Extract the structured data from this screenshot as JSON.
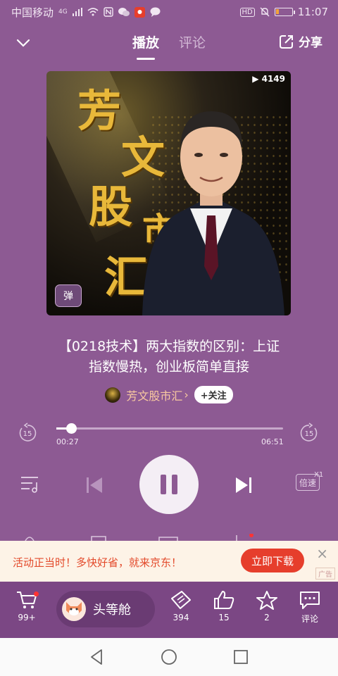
{
  "status_bar": {
    "carrier": "中国移动",
    "network": "4G",
    "hd_label": "HD",
    "time": "11:07",
    "battery_level": 0.22,
    "battery_color": "#f3a43a",
    "left_icons": [
      "signal-icon",
      "wifi-icon",
      "nfc-icon",
      "wechat-icon",
      "app-icon",
      "message-icon"
    ],
    "right_icons": [
      "hd-icon",
      "mute-icon",
      "battery-icon"
    ]
  },
  "top_nav": {
    "tabs": [
      {
        "label": "播放",
        "active": true
      },
      {
        "label": "评论",
        "active": false
      }
    ],
    "share_label": "分享"
  },
  "cover": {
    "play_count": "▶ 4149",
    "calligraphy_chars": [
      "芳",
      "文",
      "股",
      "市",
      "汇"
    ],
    "danmu_badge": "弹"
  },
  "episode": {
    "title_line1": "【0218技术】两大指数的区别：上证",
    "title_line2": "指数慢热，创业板简单直接"
  },
  "author": {
    "name": "芳文股市汇",
    "chevron": "›",
    "follow_label": "+关注"
  },
  "player": {
    "current_time": "00:27",
    "total_time": "06:51",
    "progress": 0.066,
    "rewind_seconds": "15",
    "forward_seconds": "15",
    "speed_label": "倍速",
    "speed_value": "X1"
  },
  "ad": {
    "text": "活动正当时！多快好省，就来京东！",
    "button_label": "立即下载",
    "close_symbol": "×",
    "ad_label": "广告"
  },
  "bottom_bar": {
    "cart_count": "99+",
    "first_class_label": "头等舱",
    "gift_count": "394",
    "like_count": "15",
    "favorite_count": "2",
    "comment_label": "评论"
  },
  "colors": {
    "background": "#8d5a93",
    "bottom_bar": "#7b4784",
    "ad_red": "#e63e2c",
    "author_name": "#f9c9a0"
  }
}
